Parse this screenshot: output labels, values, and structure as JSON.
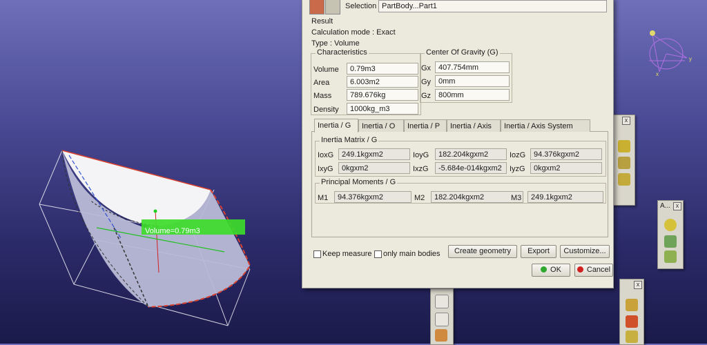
{
  "viewport": {
    "volume_tag": "Volume=0.79m3",
    "compass": {
      "x_label": "x",
      "y_label": "y"
    }
  },
  "dialog": {
    "selection_label": "Selection :",
    "selection_value": "PartBody...Part1",
    "result_label": "Result",
    "calc_mode": "Calculation mode :  Exact",
    "type": "Type :  Volume",
    "characteristics": {
      "title": "Characteristics",
      "rows": [
        {
          "label": "Volume",
          "value": "0.79m3"
        },
        {
          "label": "Area",
          "value": "6.003m2"
        },
        {
          "label": "Mass",
          "value": "789.676kg"
        },
        {
          "label": "Density",
          "value": "1000kg_m3"
        }
      ]
    },
    "cog": {
      "title": "Center Of Gravity (G)",
      "rows": [
        {
          "label": "Gx",
          "value": "407.754mm"
        },
        {
          "label": "Gy",
          "value": "0mm"
        },
        {
          "label": "Gz",
          "value": "800mm"
        }
      ]
    },
    "tabs": [
      "Inertia / G",
      "Inertia / O",
      "Inertia / P",
      "Inertia / Axis",
      "Inertia / Axis System"
    ],
    "active_tab": "Inertia / G",
    "matrix": {
      "title": "Inertia Matrix / G",
      "cells": [
        {
          "label": "IoxG",
          "value": "249.1kgxm2"
        },
        {
          "label": "IoyG",
          "value": "182.204kgxm2"
        },
        {
          "label": "IozG",
          "value": "94.376kgxm2"
        },
        {
          "label": "IxyG",
          "value": "0kgxm2"
        },
        {
          "label": "IxzG",
          "value": "-5.684e-014kgxm2"
        },
        {
          "label": "IyzG",
          "value": "0kgxm2"
        }
      ]
    },
    "principal": {
      "title": "Principal Moments / G",
      "cells": [
        {
          "label": "M1",
          "value": "94.376kgxm2"
        },
        {
          "label": "M2",
          "value": "182.204kgxm2"
        },
        {
          "label": "M3",
          "value": "249.1kgxm2"
        }
      ]
    },
    "keep_measure": "Keep measure",
    "only_main_bodies": "only main bodies",
    "create_geometry": "Create geometry",
    "export": "Export",
    "customize": "Customize...",
    "ok": "OK",
    "cancel": "Cancel"
  },
  "toolbars": {
    "right_title": "A...",
    "close_glyph": "x"
  },
  "colors": {
    "ok_dot": "#2fa82f",
    "cancel_dot": "#d02020",
    "volume_tag_bg": "#3ddc2a"
  }
}
